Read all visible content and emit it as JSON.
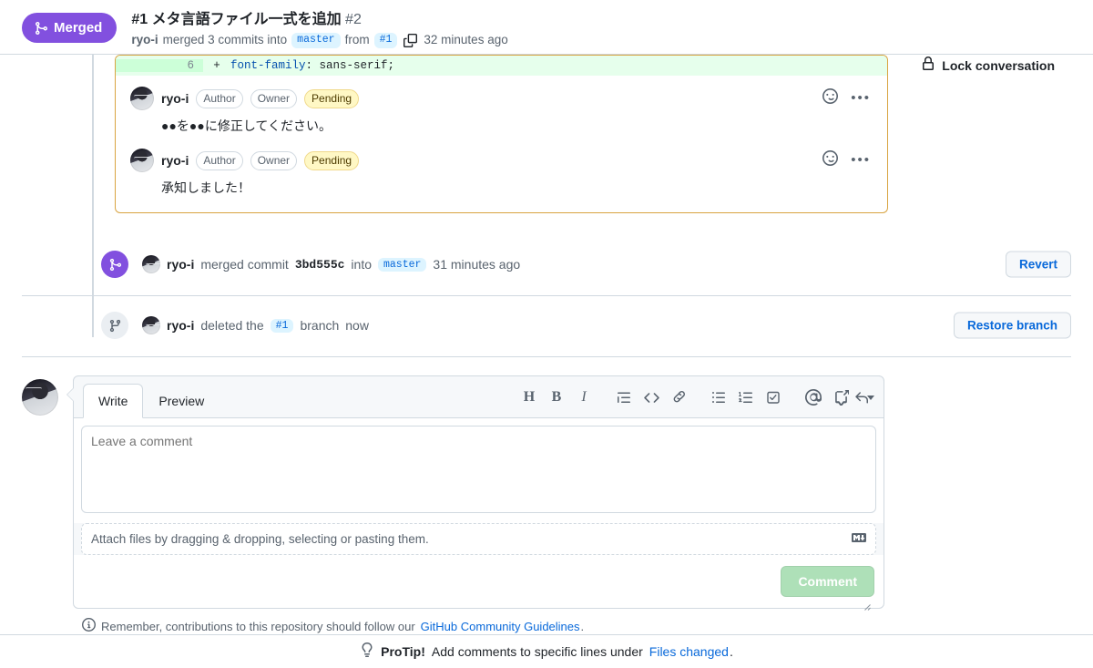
{
  "header": {
    "status_badge": "Merged",
    "status_color": "#8250df",
    "title": "#1 メタ言語ファイル一式を追加",
    "number": "#2",
    "author": "ryo-i",
    "merged_text": "merged 3 commits into",
    "base_branch": "master",
    "from_text": "from",
    "head_branch": "#1",
    "timestamp": "32 minutes ago",
    "lock_conversation": "Lock conversation"
  },
  "diff": {
    "line_number": "6",
    "sign": "+",
    "code_property": "font-family",
    "code_value": ": sans-serif;"
  },
  "review_comments": [
    {
      "user": "ryo-i",
      "badges": [
        "Author",
        "Owner",
        "Pending"
      ],
      "body": "●●を●●に修正してください。"
    },
    {
      "user": "ryo-i",
      "badges": [
        "Author",
        "Owner",
        "Pending"
      ],
      "body": "承知しました！"
    }
  ],
  "timeline": [
    {
      "user": "ryo-i",
      "action_before": "merged commit",
      "commit_sha": "3bd555c",
      "action_mid": "into",
      "branch": "master",
      "timestamp": "31 minutes ago",
      "button": "Revert"
    },
    {
      "user": "ryo-i",
      "action_before": "deleted the",
      "branch": "#1",
      "action_after": "branch",
      "timestamp": "now",
      "button": "Restore branch"
    }
  ],
  "comment_form": {
    "tabs": [
      {
        "label": "Write",
        "active": true
      },
      {
        "label": "Preview",
        "active": false
      }
    ],
    "toolbar": [
      {
        "name": "heading-icon",
        "glyph": "H"
      },
      {
        "name": "bold-icon",
        "glyph": "B"
      },
      {
        "name": "italic-icon",
        "glyph": "I"
      },
      {
        "name": "quote-icon",
        "glyph": ""
      },
      {
        "name": "code-icon",
        "glyph": ""
      },
      {
        "name": "link-icon",
        "glyph": ""
      },
      {
        "name": "unordered-list-icon",
        "glyph": ""
      },
      {
        "name": "ordered-list-icon",
        "glyph": ""
      },
      {
        "name": "task-list-icon",
        "glyph": ""
      },
      {
        "name": "mention-icon",
        "glyph": "@"
      },
      {
        "name": "reference-icon",
        "glyph": ""
      },
      {
        "name": "saved-replies-icon",
        "glyph": ""
      }
    ],
    "textarea_placeholder": "Leave a comment",
    "textarea_value": "",
    "attach_text": "Attach files by dragging & dropping, selecting or pasting them.",
    "submit_label": "Comment",
    "submit_enabled": false,
    "submit_color": "#aee0b8"
  },
  "footer": {
    "guidelines_prefix": "Remember, contributions to this repository should follow our",
    "guidelines_link": "GitHub Community Guidelines",
    "guidelines_suffix": ".",
    "protip_label": "ProTip!",
    "protip_text": "Add comments to specific lines under",
    "protip_link": "Files changed",
    "protip_suffix": "."
  }
}
